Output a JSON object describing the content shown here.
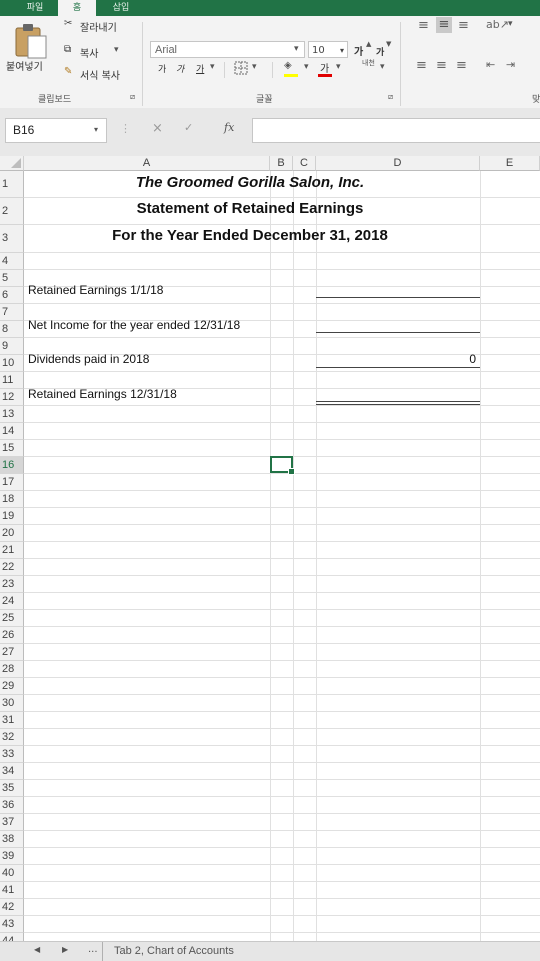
{
  "ribbon": {
    "tabs": [
      "파일",
      "홈",
      "삽입"
    ],
    "clipboard": {
      "paste_label": "붙여넣기",
      "cut_label": "잘라내기",
      "copy_label": "복사",
      "format_painter_label": "서식 복사",
      "group_label": "클립보드"
    },
    "font": {
      "font_name": "Arial",
      "font_size": "10",
      "bold": "가",
      "italic": "가",
      "underline": "가",
      "grow": "가",
      "shrink": "가",
      "phonetic": "내천",
      "group_label": "글꼴"
    },
    "edge_label": "맞"
  },
  "formula_bar": {
    "name_box": "B16",
    "fx": "fx",
    "cancel": "×",
    "confirm": "✓",
    "formula": ""
  },
  "sheet": {
    "columns": [
      "A",
      "B",
      "C",
      "D",
      "E"
    ],
    "rows": [
      "1",
      "2",
      "3",
      "4",
      "5",
      "6",
      "7",
      "8",
      "9",
      "10",
      "11",
      "12",
      "13",
      "14",
      "15",
      "16",
      "17",
      "18",
      "19",
      "20",
      "21",
      "22",
      "23",
      "24",
      "25",
      "26",
      "27",
      "28",
      "29",
      "30",
      "31",
      "32",
      "33",
      "34",
      "35",
      "36",
      "37",
      "38",
      "39",
      "40",
      "41",
      "42",
      "43",
      "44"
    ],
    "selected_row": "16",
    "selected_cell": "B16",
    "title1": "The Groomed Gorilla Salon, Inc.",
    "title2": "Statement of Retained Earnings",
    "title3": "For the Year Ended December 31, 2018",
    "row6_label": "Retained Earnings 1/1/18",
    "row8_label": "Net Income for the year ended 12/31/18",
    "row10_label": "Dividends paid in 2018",
    "row10_value": "0",
    "row12_label": "Retained Earnings 12/31/18"
  },
  "tabs_bar": {
    "ellipsis": "...",
    "sheet_tab": "Tab 2, Chart of Accounts"
  },
  "colors": {
    "excel_green": "#217346"
  }
}
